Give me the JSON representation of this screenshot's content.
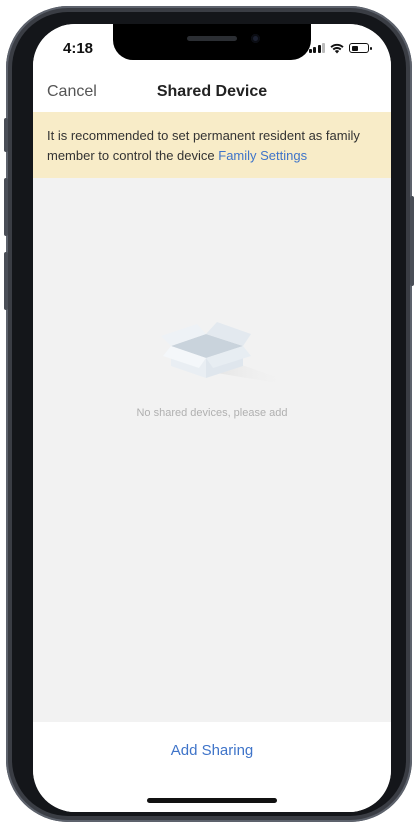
{
  "status_bar": {
    "time": "4:18",
    "battery_level": 0.45
  },
  "nav": {
    "cancel_label": "Cancel",
    "title": "Shared Device"
  },
  "banner": {
    "text": "It is recommended to set permanent resident as family member to control the device ",
    "link_label": "Family Settings"
  },
  "empty_state": {
    "message": "No shared devices, please add",
    "icon": "open-box-icon"
  },
  "footer": {
    "add_label": "Add Sharing"
  },
  "colors": {
    "accent": "#3f74c9",
    "banner_bg": "#f8ecc8",
    "page_bg": "#f2f2f2"
  }
}
